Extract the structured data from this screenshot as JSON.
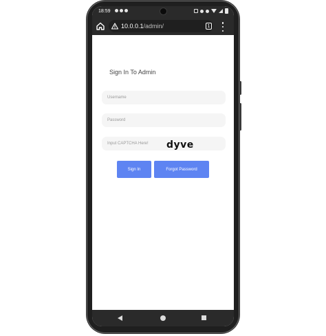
{
  "status_bar": {
    "time": "18:59"
  },
  "browser": {
    "url_host": "10.0.0.1",
    "url_path": "/admin/",
    "tab_count": "1"
  },
  "login": {
    "title": "Sign In To Admin",
    "username_placeholder": "Username",
    "password_placeholder": "Password",
    "captcha_placeholder": "Input CAPTCHA Here!",
    "captcha_text": "dyve",
    "signin_label": "Sign In",
    "forgot_label": "Forgot Password"
  },
  "colors": {
    "primary_button": "#5e84f2",
    "chrome_dark": "#2a2a2a"
  }
}
